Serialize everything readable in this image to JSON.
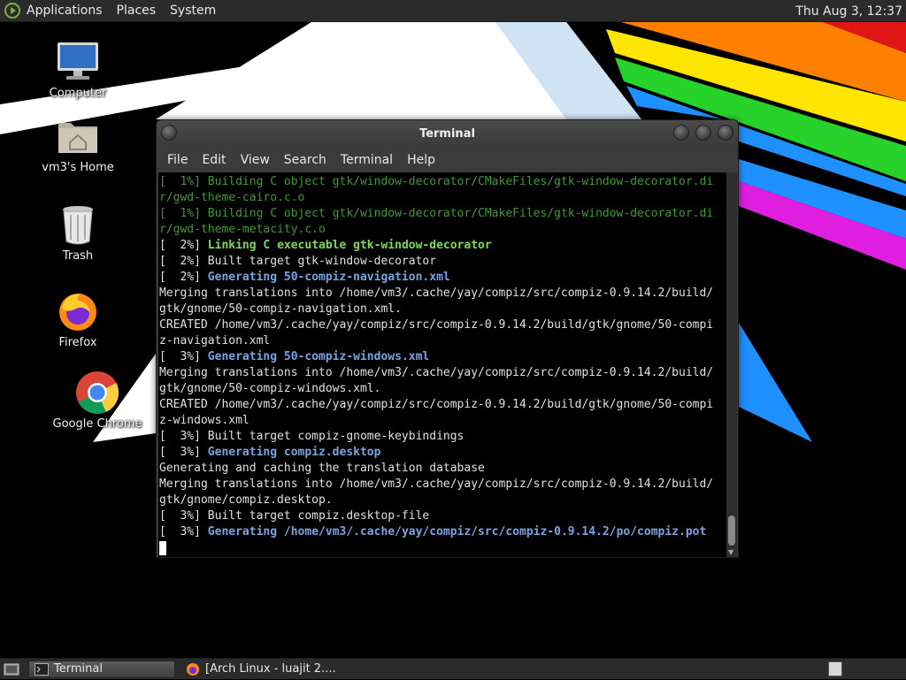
{
  "top_panel": {
    "menus": [
      "Applications",
      "Places",
      "System"
    ],
    "clock": "Thu Aug  3, 12:37"
  },
  "desktop_icons": [
    {
      "label": "Computer",
      "icon": "computer-icon"
    },
    {
      "label": "vm3's Home",
      "icon": "home-folder-icon"
    },
    {
      "label": "Trash",
      "icon": "trash-icon"
    },
    {
      "label": "Firefox",
      "icon": "firefox-icon"
    },
    {
      "label": "Google Chrome",
      "icon": "chrome-icon"
    }
  ],
  "terminal": {
    "title": "Terminal",
    "menu": [
      "File",
      "Edit",
      "View",
      "Search",
      "Terminal",
      "Help"
    ],
    "lines": [
      {
        "text": "[  1%] Building C object gtk/window-decorator/CMakeFiles/gtk-window-decorator.di",
        "style": "dim"
      },
      {
        "text": "r/gwd-theme-cairo.c.o",
        "style": "dim"
      },
      {
        "text": "[  1%] Building C object gtk/window-decorator/CMakeFiles/gtk-window-decorator.di",
        "style": "dim"
      },
      {
        "text": "r/gwd-theme-metacity.c.o",
        "style": "dim"
      },
      {
        "prefix": "[  2%] ",
        "text": "Linking C executable gtk-window-decorator",
        "style": "grn"
      },
      {
        "text": "[  2%] Built target gtk-window-decorator",
        "style": "plain"
      },
      {
        "prefix": "[  2%] ",
        "text": "Generating 50-compiz-navigation.xml",
        "style": "blu"
      },
      {
        "text": "Merging translations into /home/vm3/.cache/yay/compiz/src/compiz-0.9.14.2/build/",
        "style": "plain"
      },
      {
        "text": "gtk/gnome/50-compiz-navigation.xml.",
        "style": "plain"
      },
      {
        "text": "CREATED /home/vm3/.cache/yay/compiz/src/compiz-0.9.14.2/build/gtk/gnome/50-compi",
        "style": "plain"
      },
      {
        "text": "z-navigation.xml",
        "style": "plain"
      },
      {
        "prefix": "[  3%] ",
        "text": "Generating 50-compiz-windows.xml",
        "style": "blu"
      },
      {
        "text": "Merging translations into /home/vm3/.cache/yay/compiz/src/compiz-0.9.14.2/build/",
        "style": "plain"
      },
      {
        "text": "gtk/gnome/50-compiz-windows.xml.",
        "style": "plain"
      },
      {
        "text": "CREATED /home/vm3/.cache/yay/compiz/src/compiz-0.9.14.2/build/gtk/gnome/50-compi",
        "style": "plain"
      },
      {
        "text": "z-windows.xml",
        "style": "plain"
      },
      {
        "text": "[  3%] Built target compiz-gnome-keybindings",
        "style": "plain"
      },
      {
        "prefix": "[  3%] ",
        "text": "Generating compiz.desktop",
        "style": "blu"
      },
      {
        "text": "Generating and caching the translation database",
        "style": "plain"
      },
      {
        "text": "Merging translations into /home/vm3/.cache/yay/compiz/src/compiz-0.9.14.2/build/",
        "style": "plain"
      },
      {
        "text": "gtk/gnome/compiz.desktop.",
        "style": "plain"
      },
      {
        "text": "[  3%] Built target compiz.desktop-file",
        "style": "plain"
      },
      {
        "prefix": "[  3%] ",
        "text": "Generating /home/vm3/.cache/yay/compiz/src/compiz-0.9.14.2/po/compiz.pot",
        "style": "blu"
      }
    ]
  },
  "taskbar": {
    "tasks": [
      {
        "label": "Terminal",
        "icon": "terminal-icon",
        "active": true
      },
      {
        "label": "[Arch Linux - luajit 2....",
        "icon": "firefox-icon",
        "active": false
      }
    ]
  },
  "colors": {
    "panel_bg": "#2b2b2b",
    "terminal_bg": "#000000",
    "dim_green": "#3f9b2f",
    "bright_green": "#7ed957",
    "bright_blue": "#7aa3e0"
  }
}
